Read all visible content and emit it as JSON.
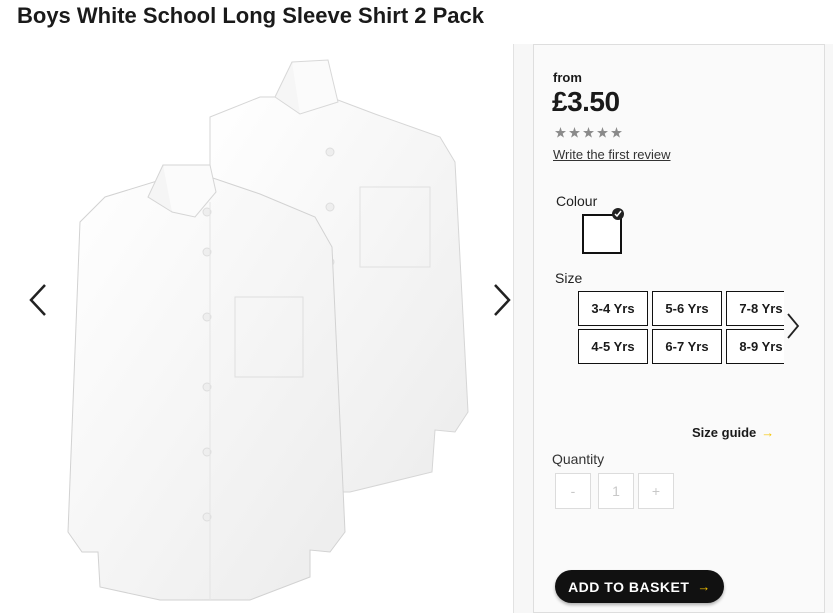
{
  "product": {
    "title": "Boys White School Long Sleeve Shirt 2 Pack"
  },
  "gallery": {
    "image_alt": "two-white-school-shirts",
    "prev_icon": "chevron-left-icon",
    "next_icon": "chevron-right-icon"
  },
  "pricing": {
    "from_label": "from",
    "price": "£3.50"
  },
  "rating": {
    "stars": 5,
    "filled": 0,
    "review_link": "Write the first review"
  },
  "colour": {
    "label": "Colour",
    "selected": "White",
    "swatch_color": "#ffffff"
  },
  "size": {
    "label": "Size",
    "options": [
      "3-4 Yrs",
      "5-6 Yrs",
      "7-8 Yrs",
      "4-5 Yrs",
      "6-7 Yrs",
      "8-9 Yrs"
    ],
    "guide_label": "Size guide"
  },
  "quantity": {
    "label": "Quantity",
    "minus": "-",
    "value": "1",
    "plus": "+"
  },
  "basket": {
    "label": "ADD TO BASKET"
  },
  "colors": {
    "accent": "#f5c400",
    "button": "#111111"
  }
}
